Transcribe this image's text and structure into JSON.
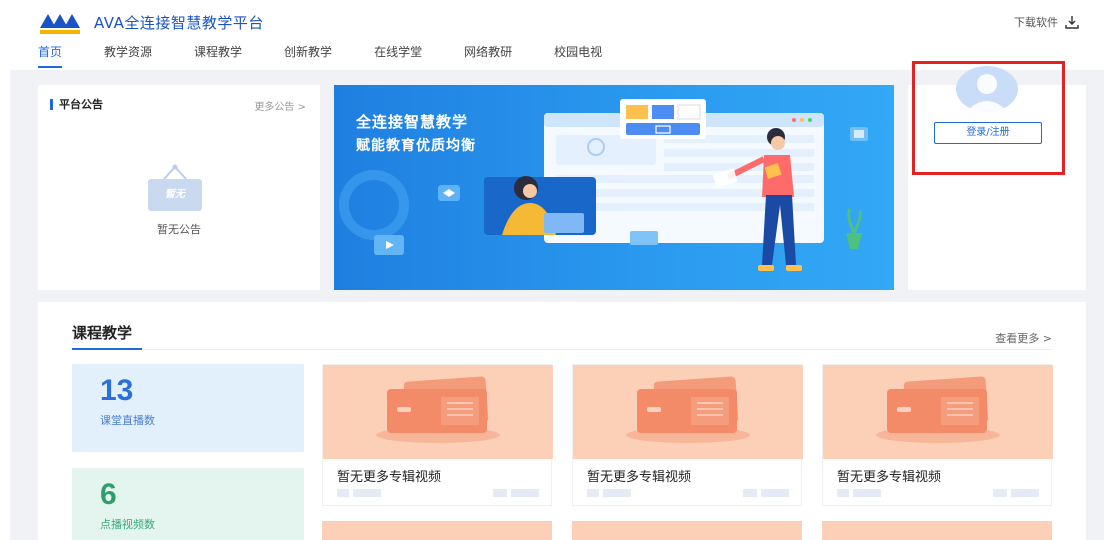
{
  "header": {
    "logo_text": "AVA全连接智慧教学平台",
    "nav": [
      {
        "label": "首页",
        "active": true
      },
      {
        "label": "教学资源"
      },
      {
        "label": "课程教学"
      },
      {
        "label": "创新教学"
      },
      {
        "label": "在线学堂"
      },
      {
        "label": "网络教研"
      },
      {
        "label": "校园电视"
      }
    ],
    "download_label": "下载软件"
  },
  "notice": {
    "title": "平台公告",
    "more": "更多公告 >",
    "empty_sign": "暂无",
    "empty_text": "暂无公告"
  },
  "banner": {
    "line1": "全连接智慧教学",
    "line2": "赋能教育优质均衡"
  },
  "login": {
    "button": "登录/注册"
  },
  "courses": {
    "title": "课程教学",
    "more": "查看更多 >",
    "stats": [
      {
        "value": "13",
        "label": "课堂直播数"
      },
      {
        "value": "6",
        "label": "点播视频数"
      }
    ],
    "videos": [
      {
        "title": "暂无更多专辑视频"
      },
      {
        "title": "暂无更多专辑视频"
      },
      {
        "title": "暂无更多专辑视频"
      }
    ]
  },
  "colors": {
    "accent": "#1e6ae4",
    "highlight_box": "#e52222",
    "thumb_bg": "#fcd0b7"
  }
}
